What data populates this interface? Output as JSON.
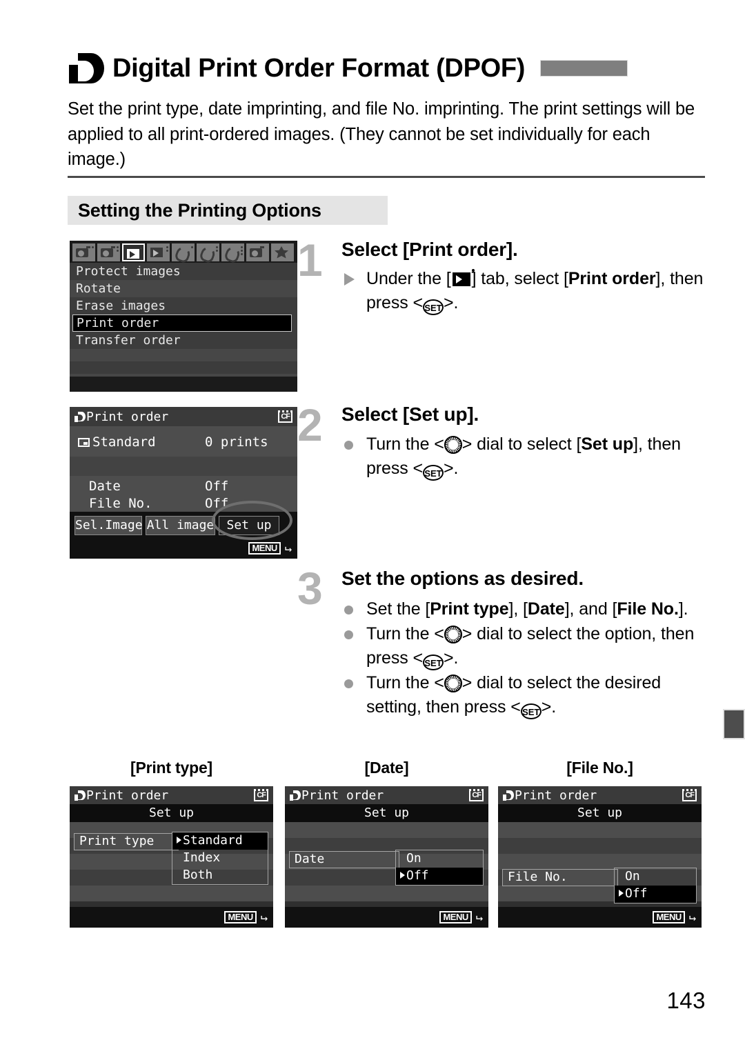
{
  "header": {
    "icon": "print-order-glyph",
    "title": "Digital Print Order Format (DPOF)"
  },
  "intro": "Set the print type, date imprinting, and file No. imprinting. The print settings will be applied to all print-ordered images. (They cannot be set individually for each image.)",
  "section": {
    "heading": "Setting the Printing Options"
  },
  "steps": [
    {
      "number": "1",
      "heading": "Select [Print order].",
      "bullets": [
        {
          "marker": "triangle",
          "parts": [
            {
              "t": "Under the [",
              "b": false
            },
            {
              "t": "playback-tab-icon",
              "icon": true
            },
            {
              "t": "] tab, select [",
              "b": false
            },
            {
              "t": "Print order",
              "b": true
            },
            {
              "t": "], then press <",
              "b": false
            },
            {
              "t": "set-button-icon",
              "icon": true
            },
            {
              "t": ">.",
              "b": false
            }
          ]
        }
      ]
    },
    {
      "number": "2",
      "heading": "Select [Set up].",
      "bullets": [
        {
          "marker": "dot",
          "parts": [
            {
              "t": "Turn the <",
              "b": false
            },
            {
              "t": "quick-control-dial-icon",
              "icon": true
            },
            {
              "t": "> dial to select [",
              "b": false
            },
            {
              "t": "Set up",
              "b": true
            },
            {
              "t": "], then press <",
              "b": false
            },
            {
              "t": "set-button-icon",
              "icon": true
            },
            {
              "t": ">.",
              "b": false
            }
          ]
        }
      ]
    },
    {
      "number": "3",
      "heading": "Set the options as desired.",
      "bullets": [
        {
          "marker": "dot",
          "parts": [
            {
              "t": "Set the [",
              "b": false
            },
            {
              "t": "Print type",
              "b": true
            },
            {
              "t": "], [",
              "b": false
            },
            {
              "t": "Date",
              "b": true
            },
            {
              "t": "], and [",
              "b": false
            },
            {
              "t": "File No.",
              "b": true
            },
            {
              "t": "].",
              "b": false
            }
          ]
        },
        {
          "marker": "dot",
          "parts": [
            {
              "t": "Turn the <",
              "b": false
            },
            {
              "t": "quick-control-dial-icon",
              "icon": true
            },
            {
              "t": "> dial to select the option, then press <",
              "b": false
            },
            {
              "t": "set-button-icon",
              "icon": true
            },
            {
              "t": ">.",
              "b": false
            }
          ]
        },
        {
          "marker": "dot",
          "parts": [
            {
              "t": "Turn the <",
              "b": false
            },
            {
              "t": "quick-control-dial-icon",
              "icon": true
            },
            {
              "t": "> dial to select the desired setting, then press <",
              "b": false
            },
            {
              "t": "set-button-icon",
              "icon": true
            },
            {
              "t": ">.",
              "b": false
            }
          ]
        }
      ]
    }
  ],
  "menu_screen": {
    "tabs": [
      {
        "name": "shooting-1-tab",
        "kind": "camera",
        "dots": 1,
        "selected": false
      },
      {
        "name": "shooting-2-tab",
        "kind": "camera",
        "dots": 2,
        "selected": false
      },
      {
        "name": "playback-1-tab",
        "kind": "play",
        "dots": 1,
        "selected": true
      },
      {
        "name": "playback-2-tab",
        "kind": "play",
        "dots": 2,
        "selected": false
      },
      {
        "name": "setup-1-tab",
        "kind": "wrench",
        "dots": 1,
        "selected": false
      },
      {
        "name": "setup-2-tab",
        "kind": "wrench",
        "dots": 2,
        "selected": false
      },
      {
        "name": "setup-3-tab",
        "kind": "wrench",
        "dots": 3,
        "selected": false
      },
      {
        "name": "custom-functions-tab",
        "kind": "camera2",
        "dots": 0,
        "selected": false
      },
      {
        "name": "my-menu-tab",
        "kind": "star",
        "dots": 0,
        "selected": false
      }
    ],
    "items": [
      {
        "label": "Protect images",
        "selected": false
      },
      {
        "label": "Rotate",
        "selected": false
      },
      {
        "label": "Erase images",
        "selected": false
      },
      {
        "label": "Print order",
        "selected": true
      },
      {
        "label": "Transfer order",
        "selected": false
      }
    ]
  },
  "print_order_screen": {
    "title": "Print order",
    "card_icon": "CF",
    "standard_label": "Standard",
    "standard_value": "0 prints",
    "rows": [
      {
        "label": "Date",
        "value": "Off"
      },
      {
        "label": "File No.",
        "value": "Off"
      }
    ],
    "buttons": [
      {
        "label": "Sel.Image",
        "highlighted": false
      },
      {
        "label": "All image",
        "highlighted": false
      },
      {
        "label": "Set up",
        "highlighted": true
      }
    ],
    "menu_badge": "MENU",
    "annotation": "ellipse-around-set-up"
  },
  "setup_screens": [
    {
      "caption": "[Print type]",
      "title": "Print order",
      "card_icon": "CF",
      "subtitle": "Set up",
      "selected_label": "Print type",
      "options": [
        {
          "label": "Standard",
          "pointer": true,
          "highlighted": true
        },
        {
          "label": "Index",
          "pointer": false,
          "highlighted": false
        },
        {
          "label": "Both",
          "pointer": false,
          "highlighted": false
        }
      ],
      "menu_badge": "MENU"
    },
    {
      "caption": "[Date]",
      "title": "Print order",
      "card_icon": "CF",
      "subtitle": "Set up",
      "selected_label": "Date",
      "options": [
        {
          "label": "On",
          "pointer": false,
          "highlighted": false
        },
        {
          "label": "Off",
          "pointer": true,
          "highlighted": true
        }
      ],
      "menu_badge": "MENU"
    },
    {
      "caption": "[File No.]",
      "title": "Print order",
      "card_icon": "CF",
      "subtitle": "Set up",
      "selected_label": "File No.",
      "options": [
        {
          "label": "On",
          "pointer": false,
          "highlighted": false
        },
        {
          "label": "Off",
          "pointer": true,
          "highlighted": true
        }
      ],
      "menu_badge": "MENU"
    }
  ],
  "page_number": "143"
}
